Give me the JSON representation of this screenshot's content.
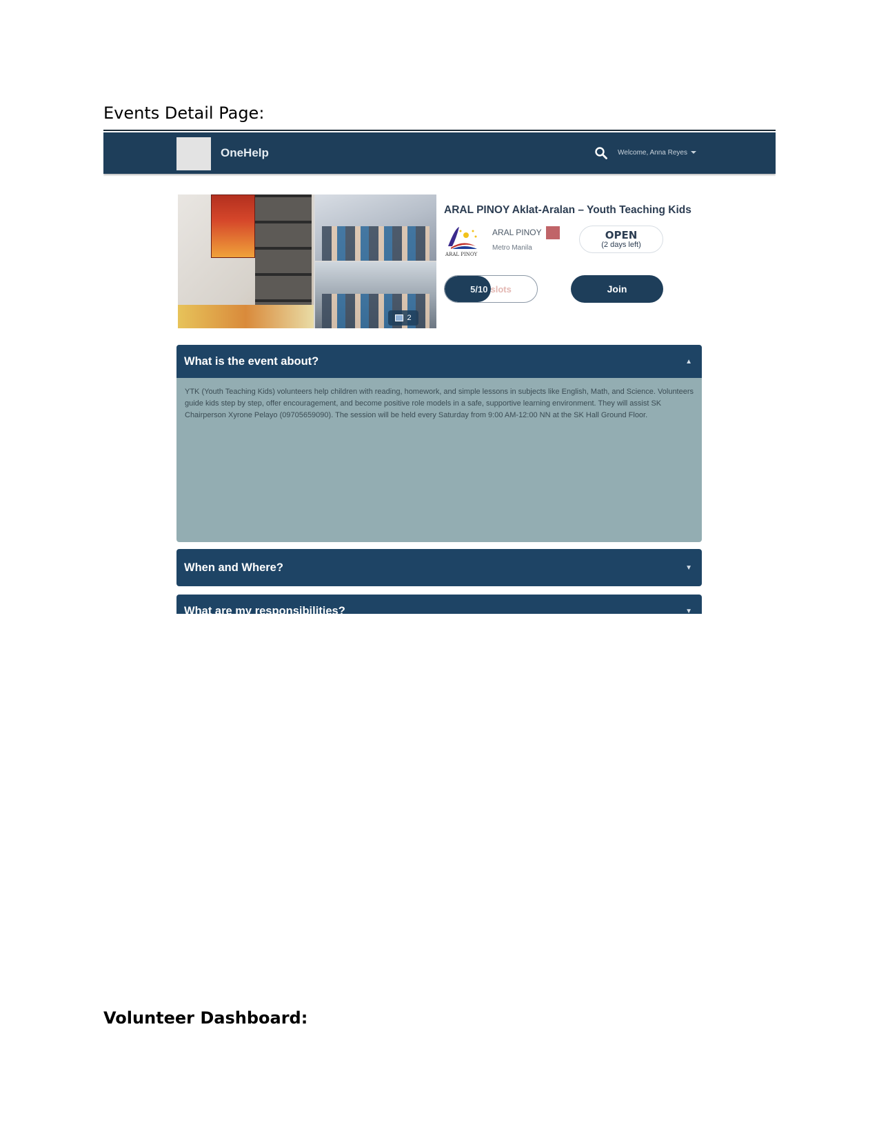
{
  "document": {
    "heading_events": "Events Detail Page:",
    "heading_dashboard": "Volunteer Dashboard:"
  },
  "navbar": {
    "brand": "OneHelp",
    "search_icon": "search-icon",
    "welcome": "Welcome, Anna Reyes",
    "background": "#1e3e5a"
  },
  "gallery": {
    "photo_count": "2"
  },
  "event": {
    "title": "ARAL PINOY Aklat-Aralan – Youth Teaching Kids",
    "organization": "ARAL PINOY",
    "organization_logo_text": "ARAL PINOY",
    "location": "Metro Manila",
    "status": "OPEN",
    "status_detail": "(2 days left)",
    "slots_count": "5/10",
    "slots_word": "slots",
    "slots_filled": 5,
    "slots_total": 10,
    "join_label": "Join",
    "flag_color": "#c06468"
  },
  "sections": {
    "about": {
      "title": "What is the event about?",
      "body": "YTK (Youth Teaching Kids) volunteers help children with reading, homework, and simple lessons in subjects like English, Math, and Science. Volunteers guide kids step by step, offer encouragement, and become positive role models in a safe, supportive learning environment. They will assist SK Chairperson Xyrone Pelayo (09705659090). The session will be held every Saturday from 9:00 AM-12:00 NN at the SK Hall Ground Floor."
    },
    "when_where": {
      "title": "When and Where?"
    },
    "responsibilities": {
      "title": "What are my responsibilities?"
    }
  }
}
